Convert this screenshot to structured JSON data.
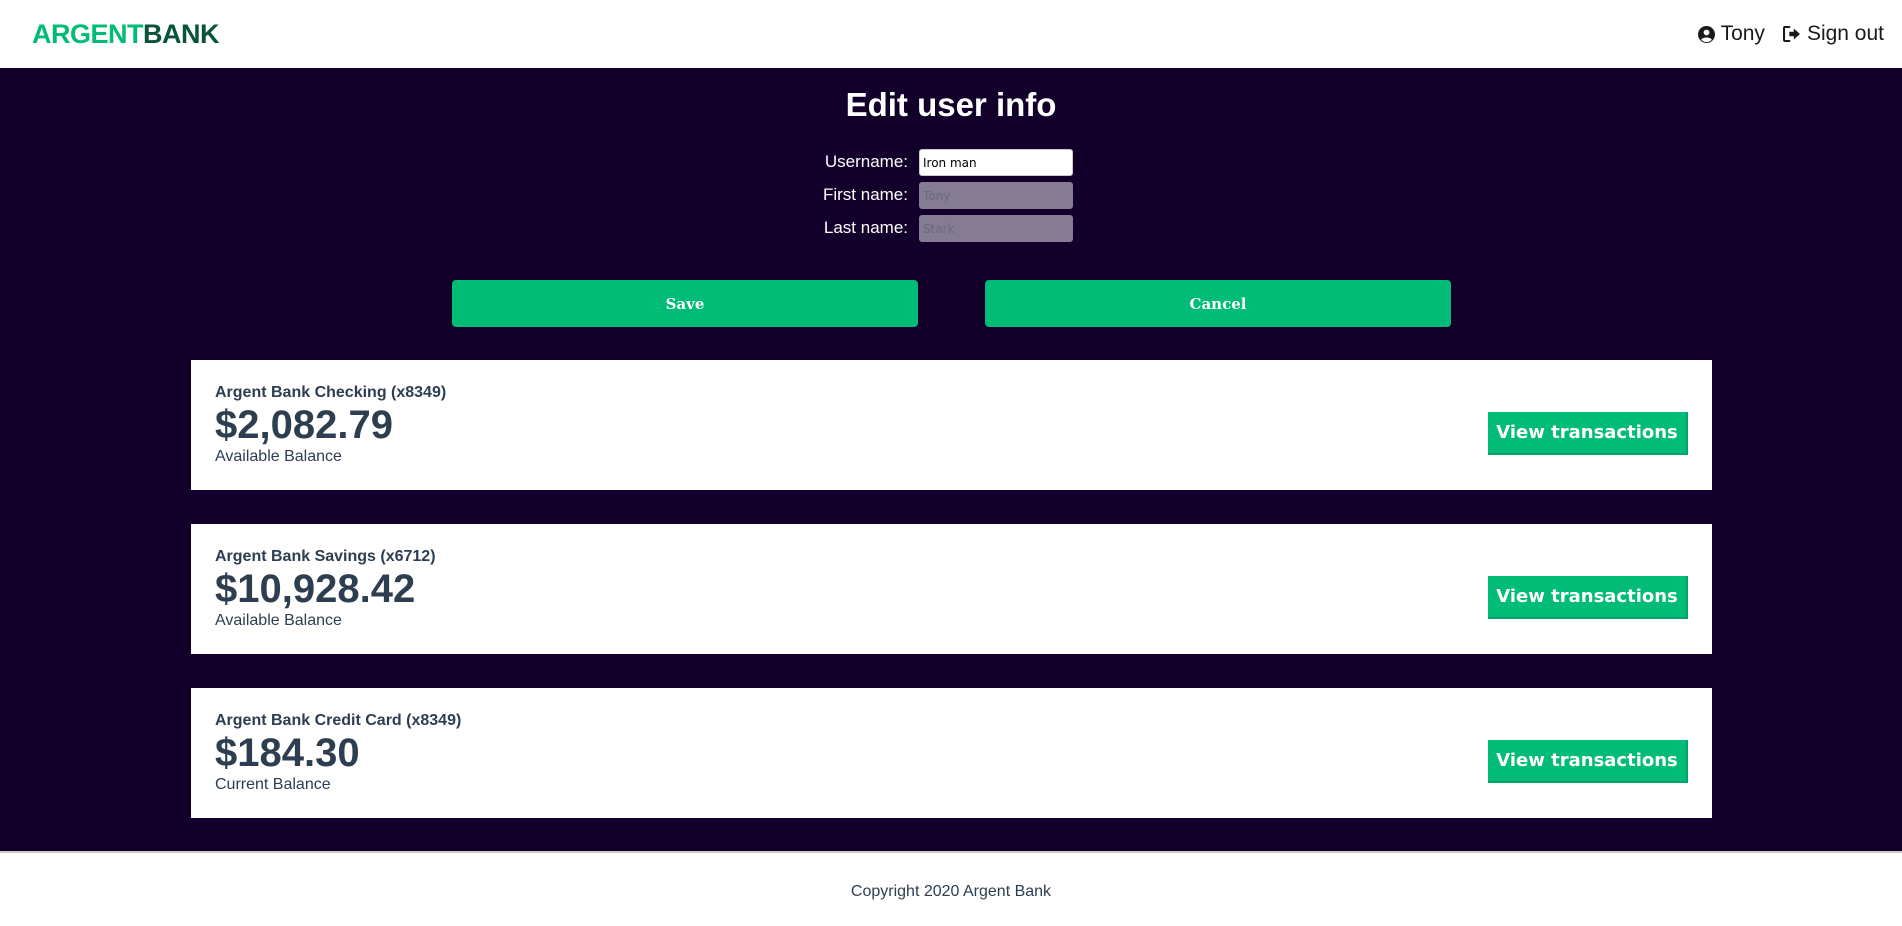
{
  "brand": {
    "part1": "ARGENT",
    "part2": "BANK",
    "colors": {
      "green": "#00bc77",
      "dark": "#12002b",
      "text": "#2c3e50"
    }
  },
  "nav": {
    "user_name": "Tony",
    "user_icon": "user-circle-icon",
    "signout_label": "Sign out",
    "signout_icon": "sign-out-icon"
  },
  "edit_form": {
    "title": "Edit user info",
    "fields": [
      {
        "label": "Username:",
        "value": "Iron man",
        "placeholder": "",
        "disabled": false
      },
      {
        "label": "First name:",
        "value": "",
        "placeholder": "Tony",
        "disabled": true
      },
      {
        "label": "Last name:",
        "value": "",
        "placeholder": "Stark",
        "disabled": true
      }
    ],
    "save_label": "Save",
    "cancel_label": "Cancel"
  },
  "accounts": [
    {
      "title": "Argent Bank Checking (x8349)",
      "amount": "$2,082.79",
      "description": "Available Balance",
      "button_label": "View transactions"
    },
    {
      "title": "Argent Bank Savings (x6712)",
      "amount": "$10,928.42",
      "description": "Available Balance",
      "button_label": "View transactions"
    },
    {
      "title": "Argent Bank Credit Card (x8349)",
      "amount": "$184.30",
      "description": "Current Balance",
      "button_label": "View transactions"
    }
  ],
  "footer": {
    "copyright": "Copyright 2020 Argent Bank"
  }
}
